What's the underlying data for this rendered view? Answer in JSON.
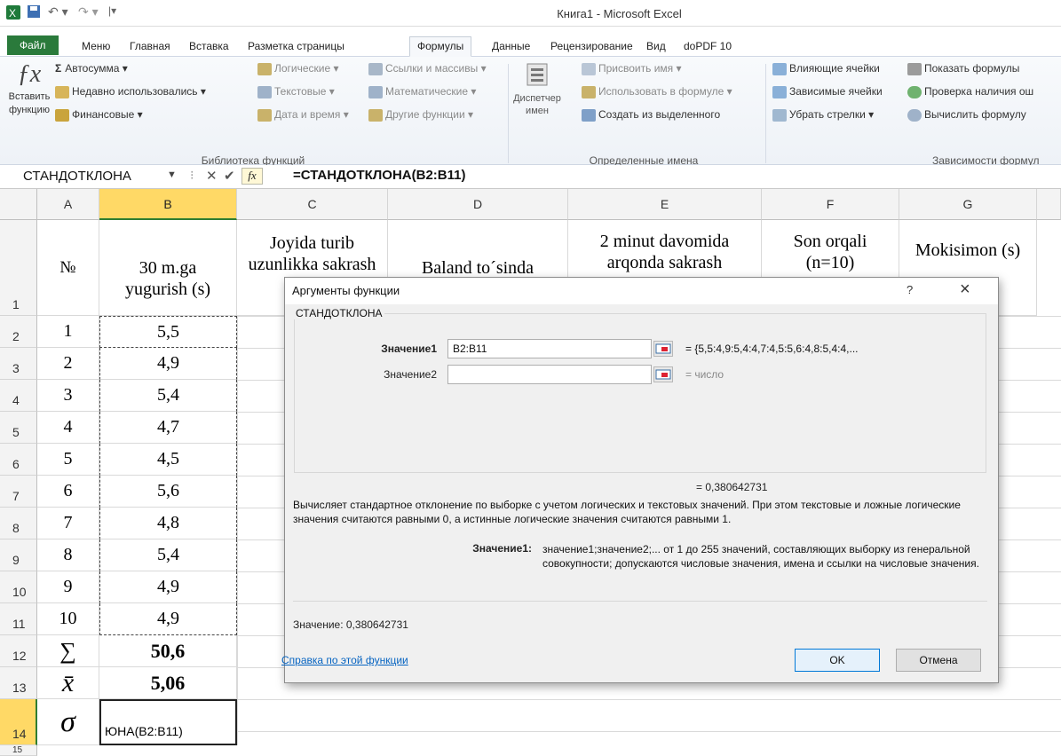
{
  "window": {
    "title": "Книга1  -  Microsoft Excel"
  },
  "tabs": [
    "Файл",
    "Меню",
    "Главная",
    "Вставка",
    "Разметка страницы",
    "Формулы",
    "Данные",
    "Рецензирование",
    "Вид",
    "doPDF 10"
  ],
  "ribbon": {
    "insert_function": [
      "Вставить",
      "функцию"
    ],
    "autosum": "Автосумма",
    "recent": "Недавно использовались",
    "financial": "Финансовые",
    "logical": "Логические",
    "text": "Текстовые",
    "datetime": "Дата и время",
    "lookup": "Ссылки и массивы",
    "math": "Математические",
    "other": "Другие функции",
    "group_library": "Библиотека функций",
    "name_manager": [
      "Диспетчер",
      "имен"
    ],
    "define_name": "Присвоить имя",
    "use_in_formula": "Использовать в формуле",
    "create_from_sel": "Создать из выделенного",
    "group_names": "Определенные имена",
    "trace_precedents": "Влияющие ячейки",
    "trace_dependents": "Зависимые ячейки",
    "remove_arrows": "Убрать стрелки",
    "show_formulas": "Показать формулы",
    "error_check": "Проверка наличия ош",
    "evaluate": "Вычислить формулу",
    "group_audit": "Зависимости формул"
  },
  "formula_bar": {
    "name_box": "СТАНДОТКЛОНА",
    "formula": "=СТАНДОТКЛОНА(B2:B11)"
  },
  "columns": [
    "A",
    "B",
    "C",
    "D",
    "E",
    "F",
    "G"
  ],
  "rows": [
    "1",
    "2",
    "3",
    "4",
    "5",
    "6",
    "7",
    "8",
    "9",
    "10",
    "11",
    "12",
    "13",
    "14",
    "15"
  ],
  "header_row": {
    "a": "№",
    "b": "30 m.ga yugurish (s)",
    "c": "Joyida turib uzunlikka sakrash",
    "d": "Baland to´sinda",
    "e": "2 minut davomida arqonda sakrash",
    "f": "Son orqali (n=10)",
    "g": "Mokisimon (s)"
  },
  "data_rows": [
    {
      "n": "1",
      "v": "5,5"
    },
    {
      "n": "2",
      "v": "4,9"
    },
    {
      "n": "3",
      "v": "5,4"
    },
    {
      "n": "4",
      "v": "4,7"
    },
    {
      "n": "5",
      "v": "4,5"
    },
    {
      "n": "6",
      "v": "5,6"
    },
    {
      "n": "7",
      "v": "4,8"
    },
    {
      "n": "8",
      "v": "5,4"
    },
    {
      "n": "9",
      "v": "4,9"
    },
    {
      "n": "10",
      "v": "4,9"
    }
  ],
  "sum_row": {
    "symbol": "∑",
    "value": "50,6"
  },
  "mean_row": {
    "symbol": "x̄",
    "value": "5,06"
  },
  "sigma_row": {
    "symbol": "σ",
    "value": "ЮНА(B2:B11)"
  },
  "dialog": {
    "title": "Аргументы функции",
    "help": "?",
    "close": "×",
    "func": "СТАНДОТКЛОНА",
    "arg1_label": "Значение1",
    "arg1_value": "B2:B11",
    "arg1_result": "=  {5,5:4,9:5,4:4,7:4,5:5,6:4,8:5,4:4,...",
    "arg2_label": "Значение2",
    "arg2_result": "=  число",
    "result_line": "=  0,380642731",
    "description": "Вычисляет стандартное отклонение по выборке с учетом логических и текстовых значений. При этом текстовые и ложные логические значения считаются равными 0, а истинные логические значения считаются равными 1.",
    "arg_help_label": "Значение1:",
    "arg_help_text": "значение1;значение2;... от 1 до 255 значений, составляющих выборку из генеральной совокупности; допускаются числовые значения, имена и ссылки на числовые значения.",
    "value_line": "Значение:   0,380642731",
    "help_link": "Справка по этой функции",
    "ok": "OK",
    "cancel": "Отмена"
  }
}
